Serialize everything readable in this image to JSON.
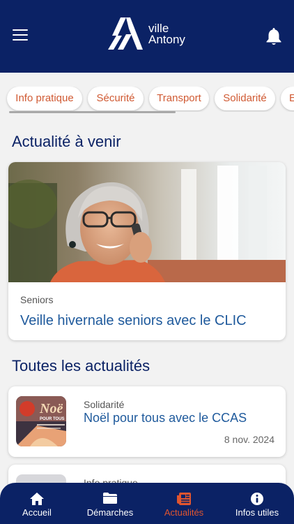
{
  "header": {
    "logo_line1": "ville",
    "logo_line2": "Antony",
    "menu_icon": "hamburger-menu-icon",
    "notification_icon": "bell-icon"
  },
  "categories": [
    "Info pratique",
    "Sécurité",
    "Transport",
    "Solidarité",
    "E"
  ],
  "upcoming": {
    "section_title": "Actualité à venir",
    "category": "Seniors",
    "title": "Veille hivernale seniors avec le CLIC"
  },
  "all_news": {
    "section_title": "Toutes les actualités",
    "items": [
      {
        "category": "Solidarité",
        "title": "Noël pour tous avec le CCAS",
        "date": "8 nov. 2024",
        "thumb_text": "Noë",
        "thumb_sub": "POUR TOUS"
      },
      {
        "category": "Info pratique",
        "title": "",
        "date": ""
      }
    ]
  },
  "bottom_nav": [
    {
      "label": "Accueil",
      "icon": "home-icon",
      "active": false
    },
    {
      "label": "Démarches",
      "icon": "folder-icon",
      "active": false
    },
    {
      "label": "Actualités",
      "icon": "newspaper-icon",
      "active": true
    },
    {
      "label": "Infos utiles",
      "icon": "info-icon",
      "active": false
    }
  ],
  "colors": {
    "header_bg": "#0b2265",
    "accent": "#e0552f",
    "chip_text": "#d05a33",
    "title_blue": "#1f5a9c",
    "page_bg": "#f2f2f2"
  }
}
